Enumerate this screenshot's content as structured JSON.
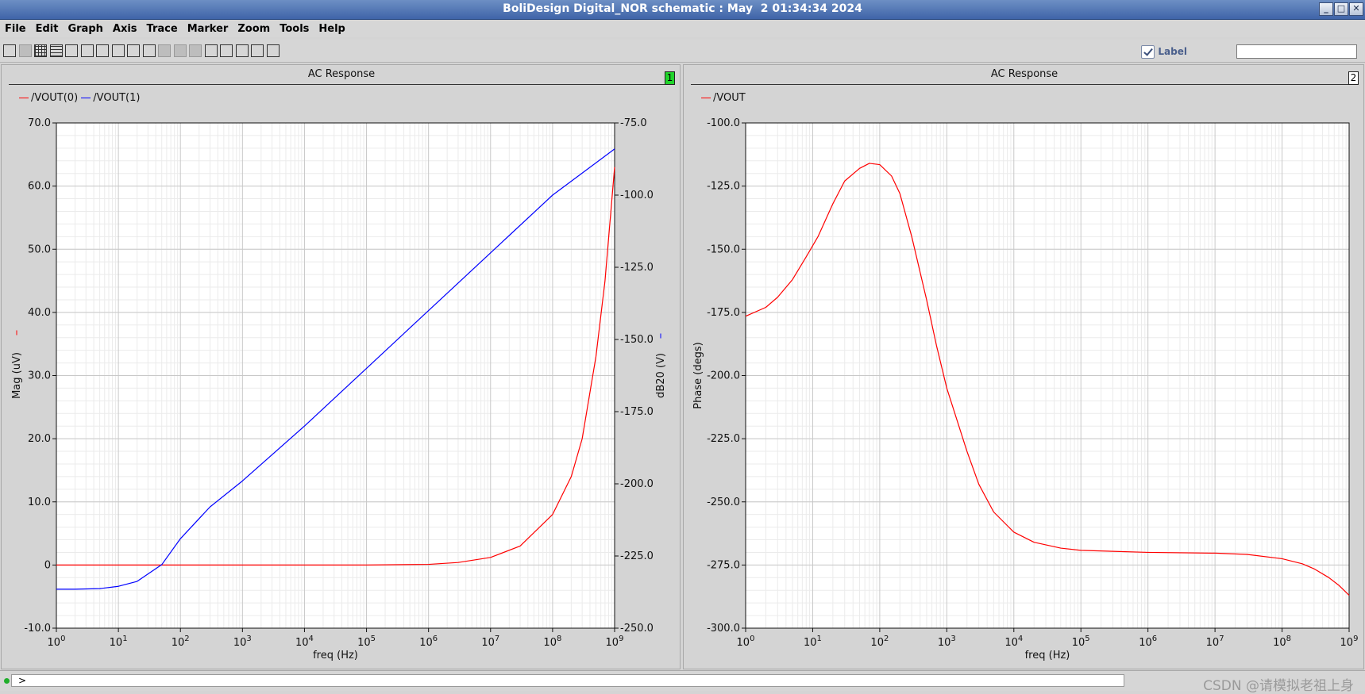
{
  "window": {
    "title": "BoliDesign Digital_NOR schematic : May  2 01:34:34 2024",
    "buttons": [
      "_",
      "□",
      "✕"
    ]
  },
  "menu": [
    "File",
    "Edit",
    "Graph",
    "Axis",
    "Trace",
    "Marker",
    "Zoom",
    "Tools",
    "Help"
  ],
  "toolbar": {
    "icons": [
      "printer-icon",
      "hardcopy-icon",
      "grid-icon",
      "strip-icon",
      "stack-icon",
      "split-icon",
      "add-subwindow-icon",
      "delete-subwindow-icon",
      "move-subwindow-icon",
      "label-toggle-icon",
      "snap-icon",
      "display-icon",
      "erase-icon",
      "table-icon",
      "fit-icon",
      "zoom-x-icon",
      "zoom-y-icon",
      "zoom-fit-icon"
    ],
    "label_checkbox": "Label",
    "label_input_value": ""
  },
  "panels": [
    {
      "title": "AC Response",
      "number": "1",
      "number_bg": "#21d42b",
      "legend": [
        {
          "name": "/VOUT(0)",
          "color": "#ff0000"
        },
        {
          "name": "/VOUT(1)",
          "color": "#0000ff"
        }
      ]
    },
    {
      "title": "AC Response",
      "number": "2",
      "number_bg": "#ffffff",
      "legend": [
        {
          "name": "/VOUT",
          "color": "#ff0000"
        }
      ]
    }
  ],
  "chart_data": [
    {
      "type": "line",
      "title": "AC Response",
      "xlabel": "freq (Hz)",
      "x_scale": "log",
      "xlim": [
        1,
        1000000000
      ],
      "x_ticks": [
        "10^0",
        "10^1",
        "10^2",
        "10^3",
        "10^4",
        "10^5",
        "10^6",
        "10^7",
        "10^8",
        "10^9"
      ],
      "ylabel_left": "Mag (uV)",
      "ylim_left": [
        -10,
        70
      ],
      "y_ticks_left": [
        "70.0",
        "60.0",
        "50.0",
        "40.0",
        "30.0",
        "20.0",
        "10.0",
        "0",
        "-10.0"
      ],
      "ylabel_right": "dB20 (V)",
      "ylim_right": [
        -250,
        -75
      ],
      "y_ticks_right": [
        "-75.0",
        "-100.0",
        "-125.0",
        "-150.0",
        "-175.0",
        "-200.0",
        "-225.0",
        "-250.0"
      ],
      "grid": true,
      "series": [
        {
          "name": "/VOUT(0)",
          "axis": "left",
          "color": "#ff0000",
          "points": [
            [
              1,
              0
            ],
            [
              10,
              0
            ],
            [
              100,
              0
            ],
            [
              1000,
              0
            ],
            [
              10000,
              0
            ],
            [
              100000,
              0
            ],
            [
              1000000,
              0.1
            ],
            [
              3000000,
              0.4
            ],
            [
              10000000,
              1.2
            ],
            [
              30000000,
              3
            ],
            [
              100000000,
              8
            ],
            [
              200000000,
              14
            ],
            [
              300000000,
              20
            ],
            [
              500000000,
              33
            ],
            [
              700000000,
              45
            ],
            [
              1000000000,
              63
            ]
          ]
        },
        {
          "name": "/VOUT(1)",
          "axis": "right",
          "color": "#0000ff",
          "points": [
            [
              1,
              -236.5
            ],
            [
              2,
              -236.5
            ],
            [
              5,
              -236.3
            ],
            [
              10,
              -235.5
            ],
            [
              20,
              -233.8
            ],
            [
              50,
              -228
            ],
            [
              100,
              -219
            ],
            [
              300,
              -208
            ],
            [
              1000,
              -199
            ],
            [
              10000,
              -180
            ],
            [
              100000,
              -160
            ],
            [
              1000000,
              -140
            ],
            [
              10000000,
              -120
            ],
            [
              100000000,
              -100
            ],
            [
              1000000000,
              -84
            ]
          ]
        }
      ]
    },
    {
      "type": "line",
      "title": "AC Response",
      "xlabel": "freq (Hz)",
      "x_scale": "log",
      "xlim": [
        1,
        1000000000
      ],
      "x_ticks": [
        "10^0",
        "10^1",
        "10^2",
        "10^3",
        "10^4",
        "10^5",
        "10^6",
        "10^7",
        "10^8",
        "10^9"
      ],
      "ylabel": "Phase (degs)",
      "ylim": [
        -300,
        -100
      ],
      "y_ticks": [
        "-100.0",
        "-125.0",
        "-150.0",
        "-175.0",
        "-200.0",
        "-225.0",
        "-250.0",
        "-275.0",
        "-300.0"
      ],
      "grid": true,
      "series": [
        {
          "name": "/VOUT",
          "color": "#ff0000",
          "points": [
            [
              1,
              -176.5
            ],
            [
              2,
              -173
            ],
            [
              3,
              -169
            ],
            [
              5,
              -162
            ],
            [
              8,
              -153
            ],
            [
              12,
              -145
            ],
            [
              20,
              -132
            ],
            [
              30,
              -123
            ],
            [
              50,
              -118
            ],
            [
              70,
              -116
            ],
            [
              100,
              -116.5
            ],
            [
              150,
              -121
            ],
            [
              200,
              -128
            ],
            [
              300,
              -145
            ],
            [
              500,
              -170
            ],
            [
              700,
              -188
            ],
            [
              1000,
              -205
            ],
            [
              2000,
              -230
            ],
            [
              3000,
              -243
            ],
            [
              5000,
              -254
            ],
            [
              10000,
              -262
            ],
            [
              20000,
              -266
            ],
            [
              50000,
              -268.3
            ],
            [
              100000,
              -269.2
            ],
            [
              1000000,
              -270
            ],
            [
              10000000,
              -270.3
            ],
            [
              30000000,
              -270.8
            ],
            [
              100000000,
              -272.5
            ],
            [
              200000000,
              -274.5
            ],
            [
              300000000,
              -276.5
            ],
            [
              500000000,
              -280
            ],
            [
              700000000,
              -283
            ],
            [
              1000000000,
              -287
            ]
          ]
        }
      ]
    }
  ],
  "status": {
    "prompt": ">",
    "watermark": "CSDN @请模拟老祖上身"
  }
}
